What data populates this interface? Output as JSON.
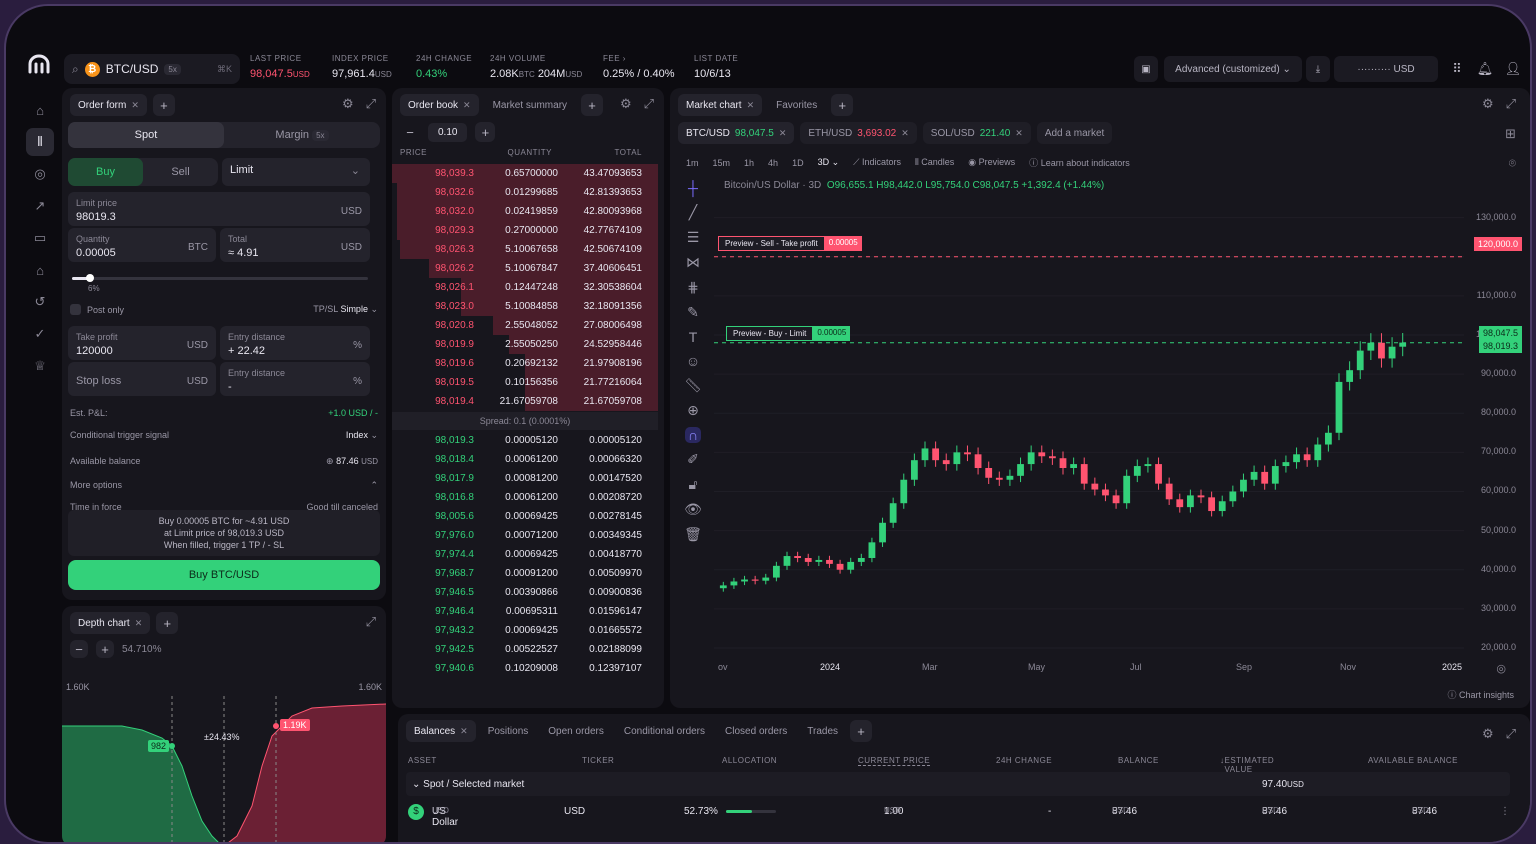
{
  "header": {
    "pair": "BTC/USD",
    "pair_badge": "5x",
    "shortcut": "⌘K",
    "stats": [
      {
        "label": "LAST PRICE",
        "value": "98,047.5",
        "unit": "USD"
      },
      {
        "label": "INDEX PRICE",
        "value": "97,961.4",
        "unit": "USD"
      },
      {
        "label": "24H CHANGE",
        "value": "0.43%",
        "unit": ""
      },
      {
        "label": "24H VOLUME",
        "value": "2.08K",
        "unit": "BTC",
        "value2": "204M",
        "unit2": "USD"
      },
      {
        "label": "FEE",
        "value": "0.25% / 0.40%",
        "unit": ""
      },
      {
        "label": "LIST DATE",
        "value": "10/6/13",
        "unit": ""
      }
    ],
    "layout_label": "Advanced (customized)",
    "balance_masked": "··········",
    "balance_unit": "USD"
  },
  "order_form": {
    "tab": "Order form",
    "mode_spot": "Spot",
    "mode_margin": "Margin",
    "margin_badge": "5x",
    "buy": "Buy",
    "sell": "Sell",
    "order_type": "Limit",
    "limit_price_label": "Limit price",
    "limit_price": "98019.3",
    "limit_unit": "USD",
    "qty_label": "Quantity",
    "qty": "0.00005",
    "qty_unit": "BTC",
    "total_label": "Total",
    "total": "≈ 4.91",
    "total_unit": "USD",
    "slider_pct": "6%",
    "slider_fraction": 0.06,
    "post_only": "Post only",
    "tpsl_label": "TP/SL",
    "tpsl_value": "Simple",
    "tp_label": "Take profit",
    "tp": "120000",
    "tp_unit": "USD",
    "entry_label": "Entry distance",
    "entry": "+ 22.42",
    "entry_unit": "%",
    "sl_label": "Stop loss",
    "sl_unit": "USD",
    "entry2_label": "Entry distance",
    "entry2": "-",
    "entry2_unit": "%",
    "pnl_label": "Est. P&L:",
    "pnl": "+1.0 USD / -",
    "trigger_label": "Conditional trigger signal",
    "trigger": "Index",
    "avail_label": "Available balance",
    "avail": "87.46",
    "avail_unit": "USD",
    "more": "More options",
    "tif_label": "Time in force",
    "tif": "Good till canceled",
    "summary1": "Buy 0.00005 BTC for ~4.91 USD",
    "summary2": "at Limit price of 98,019.3 USD",
    "summary3": "When filled, trigger 1 TP / - SL",
    "submit": "Buy BTC/USD"
  },
  "depth": {
    "tab": "Depth chart",
    "zoom": "54.710%",
    "left_top": "1.60K",
    "right_top": "1.60K",
    "bid_label": "982",
    "ask_label": "1.19K",
    "spread_label": "±24.43%"
  },
  "orderbook": {
    "tab": "Order book",
    "tab2": "Market summary",
    "size": "0.10",
    "headers": [
      "PRICE",
      "QUANTITY",
      "TOTAL"
    ],
    "asks": [
      [
        "98,039.3",
        "0.65700000",
        "43.47093653",
        1.0
      ],
      [
        "98,032.6",
        "0.01299685",
        "42.81393653",
        0.98
      ],
      [
        "98,032.0",
        "0.02419859",
        "42.80093968",
        0.98
      ],
      [
        "98,029.3",
        "0.27000000",
        "42.77674109",
        0.98
      ],
      [
        "98,026.3",
        "5.10067658",
        "42.50674109",
        0.97
      ],
      [
        "98,026.2",
        "5.10067847",
        "37.40606451",
        0.86
      ],
      [
        "98,026.1",
        "0.12447248",
        "32.30538604",
        0.74
      ],
      [
        "98,023.0",
        "5.10084858",
        "32.18091356",
        0.74
      ],
      [
        "98,020.8",
        "2.55048052",
        "27.08006498",
        0.62
      ],
      [
        "98,019.9",
        "2.55050250",
        "24.52958446",
        0.56
      ],
      [
        "98,019.6",
        "0.20692132",
        "21.97908196",
        0.5
      ],
      [
        "98,019.5",
        "0.10156356",
        "21.77216064",
        0.5
      ],
      [
        "98,019.4",
        "21.67059708",
        "21.67059708",
        0.5
      ]
    ],
    "spread": "Spread: 0.1 (0.0001%)",
    "bids": [
      [
        "98,019.3",
        "0.00005120",
        "0.00005120"
      ],
      [
        "98,018.4",
        "0.00061200",
        "0.00066320"
      ],
      [
        "98,017.9",
        "0.00081200",
        "0.00147520"
      ],
      [
        "98,016.8",
        "0.00061200",
        "0.00208720"
      ],
      [
        "98,005.6",
        "0.00069425",
        "0.00278145"
      ],
      [
        "97,976.0",
        "0.00071200",
        "0.00349345"
      ],
      [
        "97,974.4",
        "0.00069425",
        "0.00418770"
      ],
      [
        "97,968.7",
        "0.00091200",
        "0.00509970"
      ],
      [
        "97,946.5",
        "0.00390866",
        "0.00900836"
      ],
      [
        "97,946.4",
        "0.00695311",
        "0.01596147"
      ],
      [
        "97,943.2",
        "0.00069425",
        "0.01665572"
      ],
      [
        "97,942.5",
        "0.00522527",
        "0.02188099"
      ],
      [
        "97,940.6",
        "0.10209008",
        "0.12397107"
      ]
    ]
  },
  "chart": {
    "tab": "Market chart",
    "tab2": "Favorites",
    "markets": [
      {
        "pair": "BTC/USD",
        "price": "98,047.5",
        "up": true
      },
      {
        "pair": "ETH/USD",
        "price": "3,693.02",
        "up": false
      },
      {
        "pair": "SOL/USD",
        "price": "221.40",
        "up": true
      }
    ],
    "add_market": "Add a market",
    "timeframes": [
      "1m",
      "15m",
      "1h",
      "4h",
      "1D",
      "3D"
    ],
    "tools": [
      "Indicators",
      "Candles",
      "Previews",
      "Learn about indicators"
    ],
    "legend_title": "Bitcoin/US Dollar · 3D",
    "ohlc": "O96,655.1 H98,442.0 L95,754.0 C98,047.5 +1,392.4 (+1.44%)",
    "sell_preview": "Preview - Sell - Take profit",
    "sell_qty": "0.00005",
    "sell_price": "120,000.0",
    "buy_preview": "Preview - Buy - Limit",
    "buy_qty": "0.00005",
    "last_price": "98,047.5",
    "buy_price": "98,019.3",
    "y_ticks": [
      "130,000.0",
      "110,000.0",
      "100,000.0",
      "90,000.0",
      "80,000.0",
      "70,000.0",
      "60,000.0",
      "50,000.0",
      "40,000.0",
      "30,000.0",
      "20,000.0"
    ],
    "x_ticks": [
      "ov",
      "2024",
      "Mar",
      "May",
      "Jul",
      "Sep",
      "Nov",
      "2025"
    ],
    "insights": "Chart insights"
  },
  "chart_data": {
    "type": "candlestick",
    "title": "Bitcoin/US Dollar · 3D",
    "ylim": [
      20000,
      135000
    ],
    "y_ticks": [
      20000,
      30000,
      40000,
      50000,
      60000,
      70000,
      80000,
      90000,
      100000,
      110000,
      120000,
      130000
    ],
    "x_ticks": [
      "ov",
      "2024",
      "Mar",
      "May",
      "Jul",
      "Sep",
      "Nov",
      "2025"
    ],
    "close_series": [
      36000,
      37000,
      37500,
      37200,
      38000,
      41000,
      43500,
      43000,
      42000,
      42500,
      41500,
      40000,
      42000,
      43000,
      47000,
      52000,
      57000,
      63000,
      68000,
      71000,
      68000,
      67000,
      70000,
      69500,
      66000,
      63500,
      63000,
      64000,
      67000,
      70000,
      69000,
      68500,
      66000,
      67000,
      62000,
      60500,
      59000,
      57000,
      64000,
      66500,
      67000,
      62000,
      58000,
      56000,
      59000,
      58500,
      55000,
      57500,
      60000,
      63000,
      65000,
      62000,
      66500,
      67500,
      69500,
      68000,
      72000,
      75000,
      88000,
      91000,
      96000,
      98000,
      94000,
      97000,
      98047.5
    ],
    "horizontal_lines": [
      {
        "label": "Preview - Sell - Take profit",
        "y": 120000
      },
      {
        "label": "Preview - Buy - Limit",
        "y": 98019.3
      }
    ]
  },
  "balances": {
    "tabs": [
      "Balances",
      "Positions",
      "Open orders",
      "Conditional orders",
      "Closed orders",
      "Trades"
    ],
    "headers": [
      "ASSET",
      "TICKER",
      "ALLOCATION",
      "CURRENT PRICE",
      "24H CHANGE",
      "BALANCE",
      "ESTIMATED VALUE",
      "AVAILABLE BALANCE"
    ],
    "group": "Spot / Selected market",
    "group_value": "97.40",
    "group_unit": "USD",
    "rows": [
      {
        "asset": "US Dollar",
        "asset_ticker": "USD",
        "ticker": "USD",
        "allocation": "52.73%",
        "allocation_fraction": 0.5273,
        "price": "1.00",
        "price_unit": "USD",
        "change": "-",
        "balance": "87.46",
        "balance_unit": "USD",
        "value": "87.46",
        "value_unit": "USD",
        "available": "87.46",
        "available_unit": "USD"
      }
    ]
  },
  "colors": {
    "green": "#33d17a",
    "red": "#ff5470",
    "bg": "#0c0b10",
    "panel": "#17161d",
    "accent": "#7132f5"
  }
}
